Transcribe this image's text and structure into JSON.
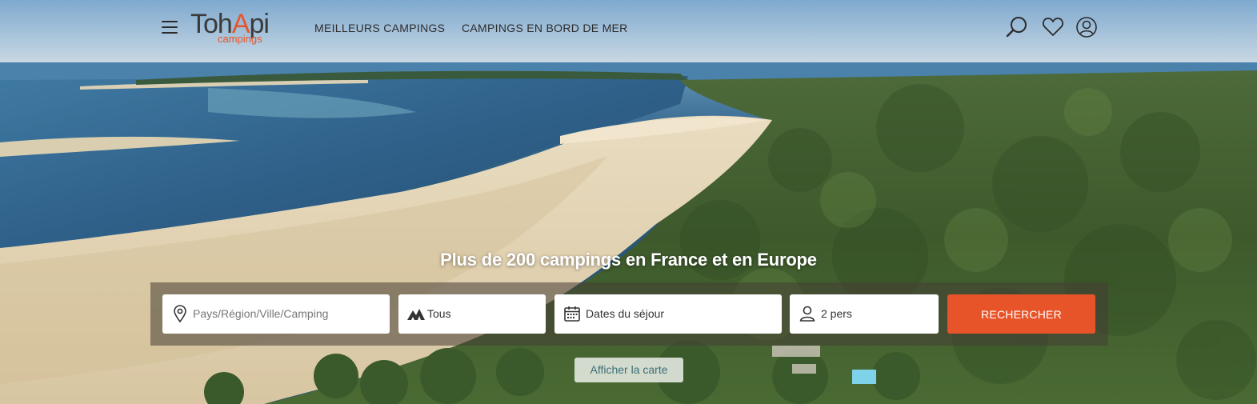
{
  "header": {
    "menu_icon": "hamburger-menu-icon",
    "logo": {
      "main_left": "Toh",
      "main_accent": "A",
      "main_right": "pi",
      "sub": "campings"
    },
    "nav": [
      {
        "label": "MEILLEURS CAMPINGS"
      },
      {
        "label": "CAMPINGS EN BORD DE MER"
      }
    ],
    "icons": [
      "search-icon",
      "favorites-heart-icon",
      "account-user-icon"
    ]
  },
  "hero": {
    "headline": "Plus de 200 campings en France et en Europe"
  },
  "search": {
    "destination": {
      "placeholder": "Pays/Région/Ville/Camping",
      "icon": "location-pin-icon"
    },
    "type": {
      "value": "Tous",
      "icon": "tent-icon"
    },
    "dates": {
      "value": "Dates du séjour",
      "icon": "calendar-icon"
    },
    "guests": {
      "value": "2 pers",
      "icon": "person-icon"
    },
    "submit_label": "RECHERCHER"
  },
  "map_button_label": "Afficher la carte",
  "colors": {
    "accent": "#e8542a",
    "text_dark": "#2c2c2c",
    "map_text": "#3d6f78"
  }
}
